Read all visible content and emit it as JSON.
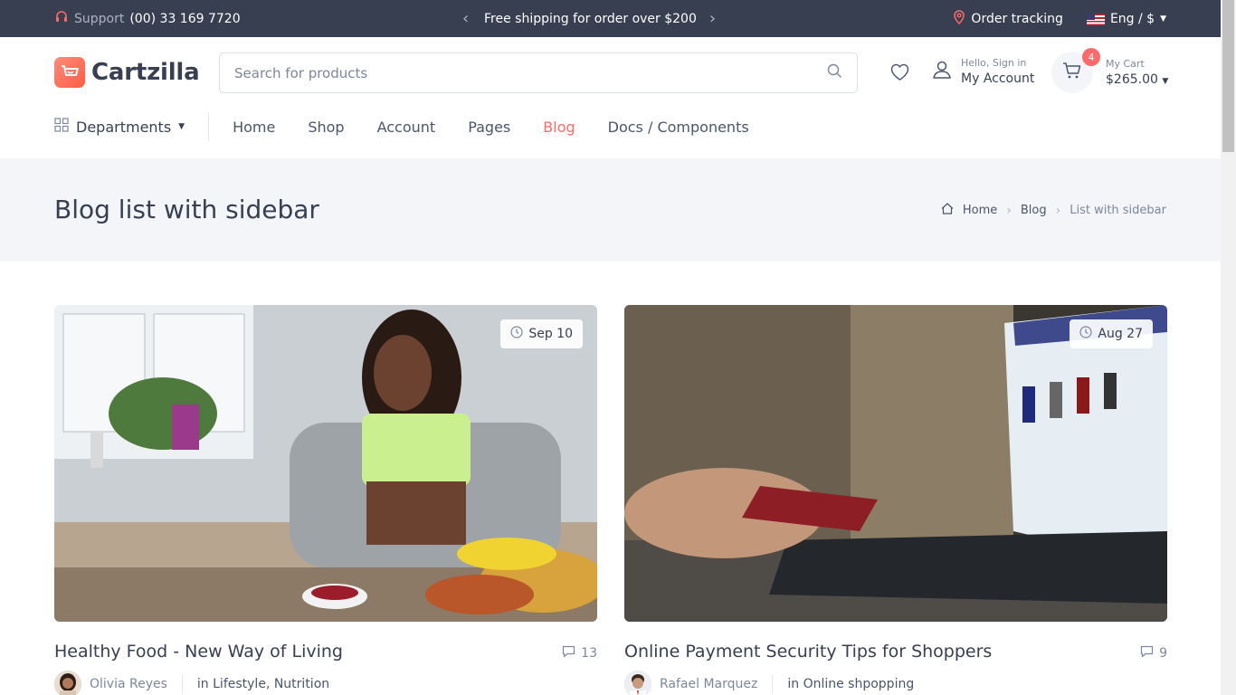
{
  "topbar": {
    "support_label": "Support",
    "support_phone": "(00) 33 169 7720",
    "promo": "Free shipping for order over $200",
    "order_tracking": "Order tracking",
    "language": "Eng / $"
  },
  "header": {
    "logo": "Cartzilla",
    "search_placeholder": "Search for products",
    "account_greeting": "Hello, Sign in",
    "account_label": "My Account",
    "cart_label": "My Cart",
    "cart_total": "$265.00",
    "cart_count": "4"
  },
  "nav": {
    "departments": "Departments",
    "links": [
      "Home",
      "Shop",
      "Account",
      "Pages",
      "Blog",
      "Docs / Components"
    ],
    "active": "Blog"
  },
  "page": {
    "title": "Blog list with sidebar",
    "breadcrumb": [
      "Home",
      "Blog",
      "List with sidebar"
    ]
  },
  "posts": [
    {
      "title": "Healthy Food - New Way of Living",
      "date": "Sep 10",
      "comments": "13",
      "author": "Olivia Reyes",
      "categories": "in Lifestyle, Nutrition"
    },
    {
      "title": "Online Payment Security Tips for Shoppers",
      "date": "Aug 27",
      "comments": "9",
      "author": "Rafael Marquez",
      "categories": "in Online shpopping"
    }
  ],
  "colors": {
    "topbar_bg": "#373f50",
    "accent": "#fe696a",
    "page_title_bg": "#f3f5f9"
  }
}
